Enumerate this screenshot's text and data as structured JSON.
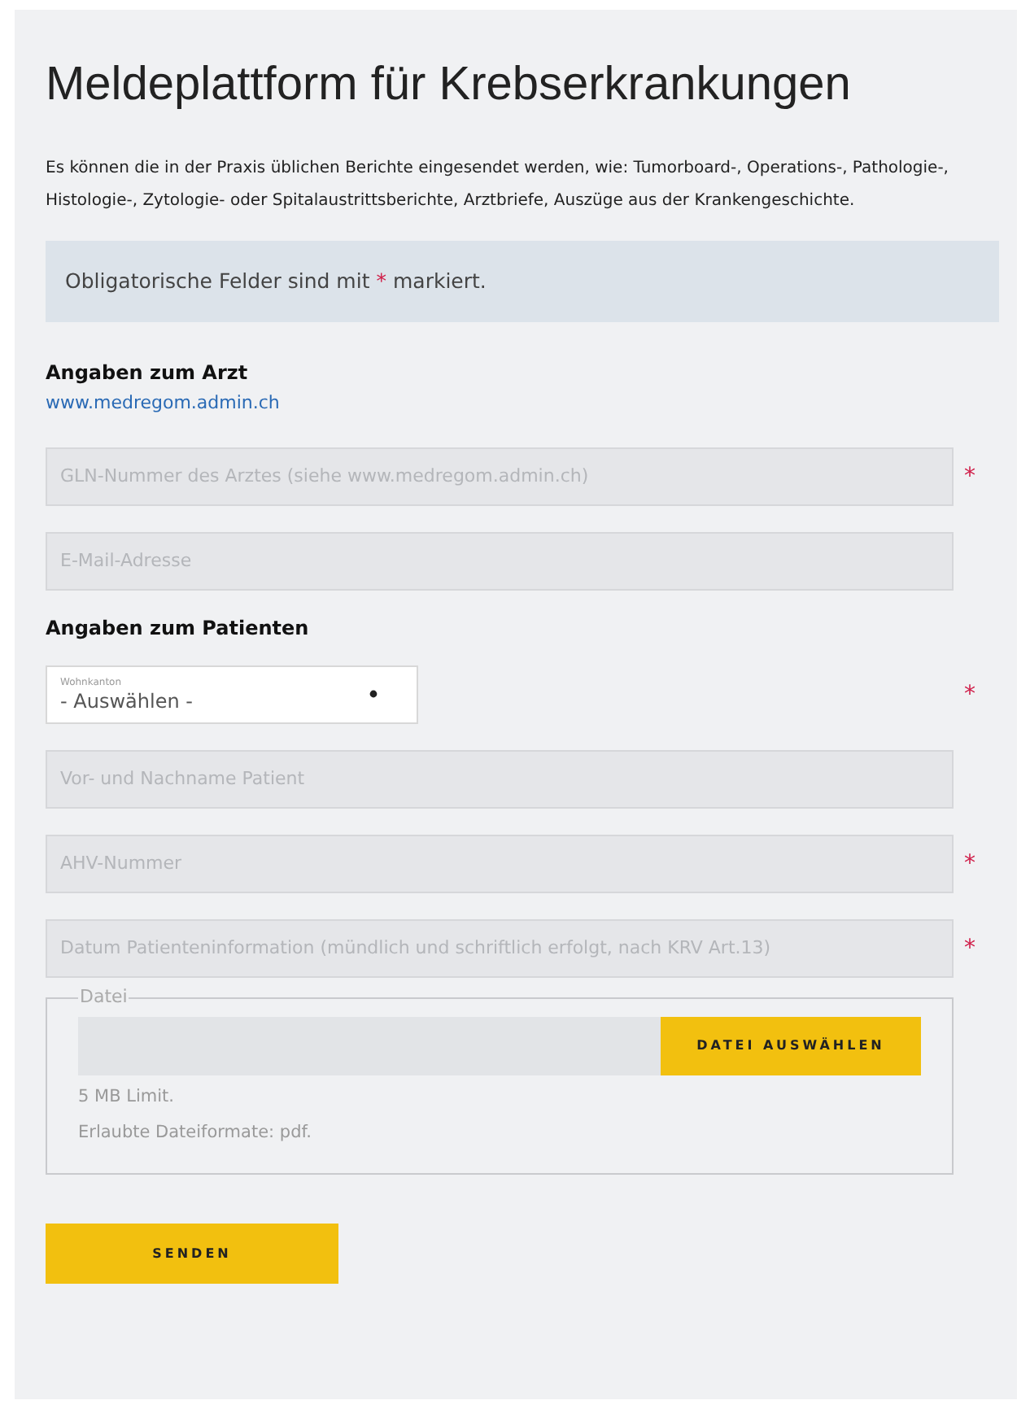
{
  "title": "Meldeplattform für Krebserkrankungen",
  "intro": "Es können die in der Praxis üblichen Berichte eingesendet werden, wie: Tumorboard-, Operations-, Pathologie-, Histologie-, Zytologie- oder Spitalaustrittsberichte, Arztbriefe, Auszüge aus der Krankengeschichte.",
  "notice": {
    "before": "Obligatorische Felder sind mit",
    "mark": "*",
    "after": "markiert."
  },
  "sections": [
    {
      "heading": "Angaben zum Arzt",
      "link": "www.medregom.admin.ch",
      "fields": [
        {
          "kind": "text",
          "placeholder": "GLN-Nummer des Arztes (siehe www.medregom.admin.ch)",
          "required": true
        },
        {
          "kind": "text",
          "placeholder": "E-Mail-Adresse",
          "required": false
        }
      ]
    },
    {
      "heading": "Angaben zum Patienten",
      "fields": [
        {
          "kind": "select",
          "label": "Wohnkanton",
          "value": "- Auswählen -",
          "required": true
        },
        {
          "kind": "text",
          "placeholder": "Vor- und Nachname Patient",
          "required": false
        },
        {
          "kind": "text",
          "placeholder": "AHV-Nummer",
          "required": true
        },
        {
          "kind": "text",
          "placeholder": "Datum Patienteninformation (mündlich und schriftlich erfolgt, nach KRV Art.13)",
          "required": true
        }
      ]
    }
  ],
  "file": {
    "legend": "Datei",
    "button": "DATEI AUSWÄHLEN",
    "notes": [
      "5 MB Limit.",
      "Erlaubte Dateiformate: pdf."
    ]
  },
  "submit": "SENDEN"
}
